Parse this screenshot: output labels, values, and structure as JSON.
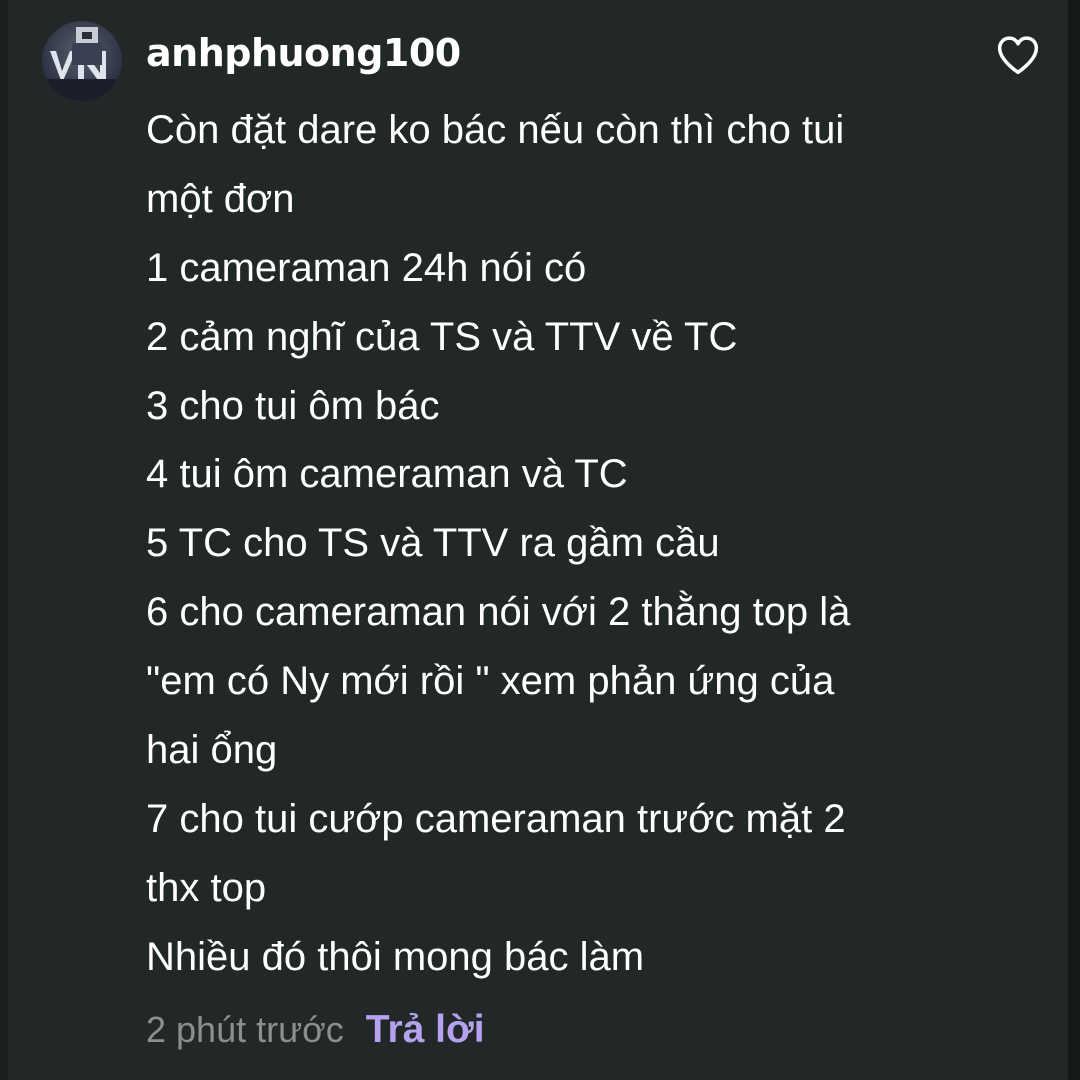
{
  "comment": {
    "username": "anhphuong100",
    "avatar_icon": "avatar-vn-icon",
    "like_icon": "heart-outline-icon",
    "body_lines": [
      "Còn đặt dare ko bác nếu còn thì cho tui",
      "một đơn",
      "1 cameraman 24h nói có",
      "2 cảm nghĩ của TS và TTV về TC",
      "3 cho tui ôm bác",
      "4 tui ôm cameraman và TC",
      "5 TC cho TS và TTV ra gầm cầu",
      "6 cho cameraman nói với 2 thằng top là",
      "\"em có Ny mới rồi \" xem phản ứng của",
      "hai ổng",
      "7 cho tui cướp cameraman trước mặt 2",
      "thx top",
      "Nhiều đó thôi mong bác làm"
    ],
    "timestamp": "2 phút trước",
    "reply_label": "Trả lời"
  },
  "colors": {
    "background": "#212827",
    "text": "#ffffff",
    "muted": "#8b8f8f",
    "accent": "#b4a2ee"
  }
}
